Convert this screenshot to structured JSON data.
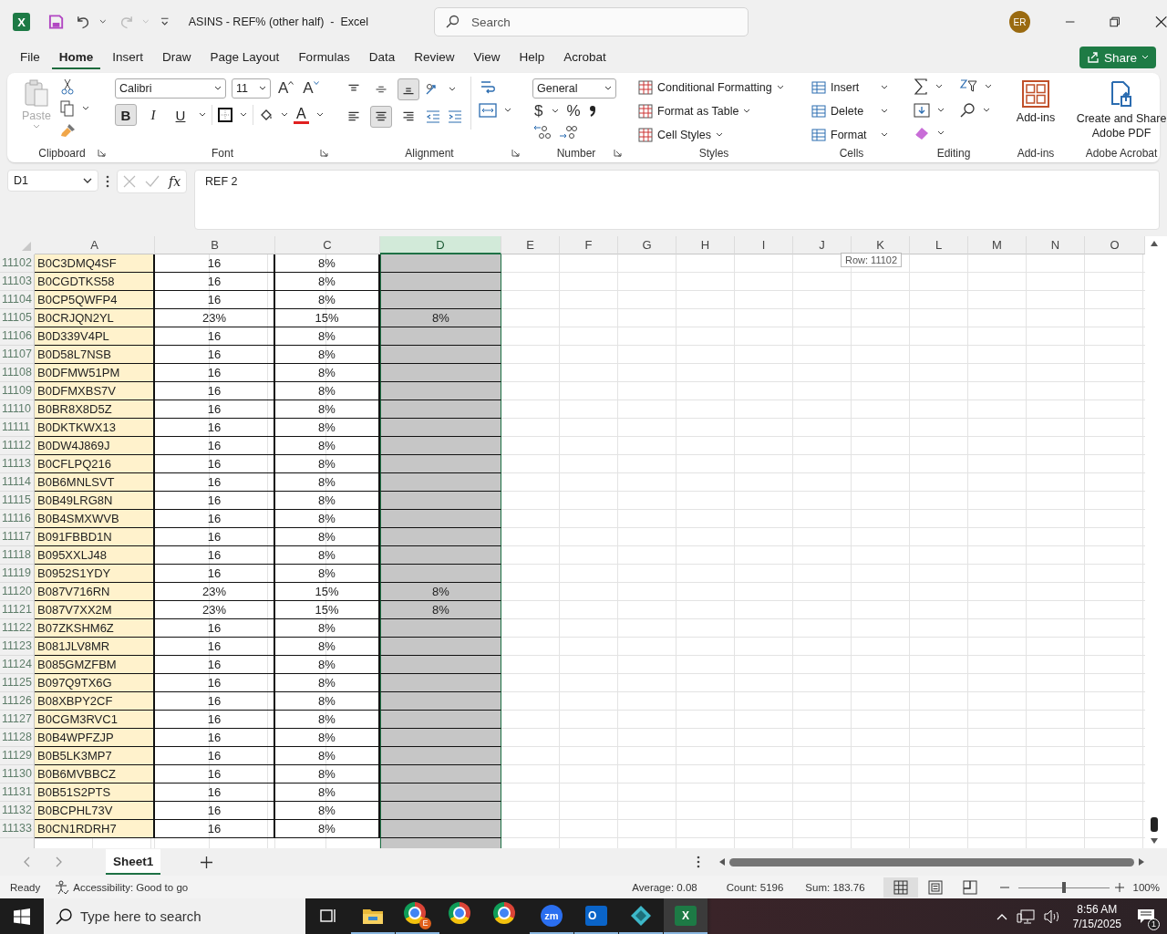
{
  "title_bar": {
    "app_letter": "X",
    "title": "ASINS - REF% (other half)  -  Excel",
    "search_placeholder": "Search",
    "avatar": "ER"
  },
  "menu_tabs": [
    {
      "label": "File",
      "selected": false
    },
    {
      "label": "Home",
      "selected": true
    },
    {
      "label": "Insert",
      "selected": false
    },
    {
      "label": "Draw",
      "selected": false
    },
    {
      "label": "Page Layout",
      "selected": false
    },
    {
      "label": "Formulas",
      "selected": false
    },
    {
      "label": "Data",
      "selected": false
    },
    {
      "label": "Review",
      "selected": false
    },
    {
      "label": "View",
      "selected": false
    },
    {
      "label": "Help",
      "selected": false
    },
    {
      "label": "Acrobat",
      "selected": false
    }
  ],
  "share_button": "Share",
  "ribbon": {
    "clipboard": {
      "paste": "Paste",
      "label": "Clipboard"
    },
    "font": {
      "family": "Calibri",
      "size": "11",
      "grow": "A",
      "shrink": "A",
      "font_color": "A",
      "label": "Font",
      "buttons": [
        {
          "kind": "bold",
          "glyph": "B",
          "selected": true
        },
        {
          "kind": "italic",
          "glyph": "I",
          "selected": false
        },
        {
          "kind": "underline",
          "glyph": "U",
          "selected": false
        }
      ]
    },
    "alignment": {
      "label": "Alignment",
      "vertical": [
        {
          "kind": "top",
          "selected": false
        },
        {
          "kind": "middle",
          "selected": false
        },
        {
          "kind": "bottom",
          "selected": true
        }
      ],
      "horizontal": [
        {
          "kind": "left",
          "selected": false
        },
        {
          "kind": "center",
          "selected": true
        },
        {
          "kind": "right",
          "selected": false
        }
      ]
    },
    "number": {
      "format": "General",
      "currency": "$",
      "percent": "%",
      "label": "Number"
    },
    "styles": {
      "items": [
        "Conditional Formatting",
        "Format as Table",
        "Cell Styles"
      ],
      "label": "Styles"
    },
    "cells": {
      "items": [
        "Insert",
        "Delete",
        "Format"
      ],
      "label": "Cells"
    },
    "editing": {
      "label": "Editing"
    },
    "addins": {
      "button": "Add-ins",
      "label": "Add-ins"
    },
    "acrobat": {
      "button": "Create and Share Adobe PDF",
      "label": "Adobe Acrobat"
    }
  },
  "formula_bar": {
    "name_box": "D1",
    "function_label": "fx",
    "formula": "REF 2"
  },
  "grid": {
    "columns": [
      {
        "label": "A",
        "selected": false
      },
      {
        "label": "B",
        "selected": false
      },
      {
        "label": "C",
        "selected": false
      },
      {
        "label": "D",
        "selected": true
      },
      {
        "label": "E",
        "selected": false
      },
      {
        "label": "F",
        "selected": false
      },
      {
        "label": "G",
        "selected": false
      },
      {
        "label": "H",
        "selected": false
      },
      {
        "label": "I",
        "selected": false
      },
      {
        "label": "J",
        "selected": false
      },
      {
        "label": "K",
        "selected": false
      },
      {
        "label": "L",
        "selected": false
      },
      {
        "label": "M",
        "selected": false
      },
      {
        "label": "N",
        "selected": false
      },
      {
        "label": "O",
        "selected": false
      }
    ],
    "rows": [
      {
        "row": "11102",
        "cells": [
          "B0C3DMQ4SF",
          "16",
          "8%"
        ]
      },
      {
        "row": "11103",
        "cells": [
          "B0CGDTKS58",
          "16",
          "8%"
        ]
      },
      {
        "row": "11104",
        "cells": [
          "B0CP5QWFP4",
          "16",
          "8%"
        ]
      },
      {
        "row": "11105",
        "cells": [
          "B0CRJQN2YL",
          "23%",
          "15%",
          "8%"
        ]
      },
      {
        "row": "11106",
        "cells": [
          "B0D339V4PL",
          "16",
          "8%"
        ]
      },
      {
        "row": "11107",
        "cells": [
          "B0D58L7NSB",
          "16",
          "8%"
        ]
      },
      {
        "row": "11108",
        "cells": [
          "B0DFMW51PM",
          "16",
          "8%"
        ]
      },
      {
        "row": "11109",
        "cells": [
          "B0DFMXBS7V",
          "16",
          "8%"
        ]
      },
      {
        "row": "11110",
        "cells": [
          "B0BR8X8D5Z",
          "16",
          "8%"
        ]
      },
      {
        "row": "11111",
        "cells": [
          "B0DKTKWX13",
          "16",
          "8%"
        ]
      },
      {
        "row": "11112",
        "cells": [
          "B0DW4J869J",
          "16",
          "8%"
        ]
      },
      {
        "row": "11113",
        "cells": [
          "B0CFLPQ216",
          "16",
          "8%"
        ]
      },
      {
        "row": "11114",
        "cells": [
          "B0B6MNLSVT",
          "16",
          "8%"
        ]
      },
      {
        "row": "11115",
        "cells": [
          "B0B49LRG8N",
          "16",
          "8%"
        ]
      },
      {
        "row": "11116",
        "cells": [
          "B0B4SMXWVB",
          "16",
          "8%"
        ]
      },
      {
        "row": "11117",
        "cells": [
          "B091FBBD1N",
          "16",
          "8%"
        ]
      },
      {
        "row": "11118",
        "cells": [
          "B095XXLJ48",
          "16",
          "8%"
        ]
      },
      {
        "row": "11119",
        "cells": [
          "B0952S1YDY",
          "16",
          "8%"
        ]
      },
      {
        "row": "11120",
        "cells": [
          "B087V716RN",
          "23%",
          "15%",
          "8%"
        ]
      },
      {
        "row": "11121",
        "cells": [
          "B087V7XX2M",
          "23%",
          "15%",
          "8%"
        ]
      },
      {
        "row": "11122",
        "cells": [
          "B07ZKSHM6Z",
          "16",
          "8%"
        ]
      },
      {
        "row": "11123",
        "cells": [
          "B081JLV8MR",
          "16",
          "8%"
        ]
      },
      {
        "row": "11124",
        "cells": [
          "B085GMZFBM",
          "16",
          "8%"
        ]
      },
      {
        "row": "11125",
        "cells": [
          "B097Q9TX6G",
          "16",
          "8%"
        ]
      },
      {
        "row": "11126",
        "cells": [
          "B08XBPY2CF",
          "16",
          "8%"
        ]
      },
      {
        "row": "11127",
        "cells": [
          "B0CGM3RVC1",
          "16",
          "8%"
        ]
      },
      {
        "row": "11128",
        "cells": [
          "B0B4WPFZJP",
          "16",
          "8%"
        ]
      },
      {
        "row": "11129",
        "cells": [
          "B0B5LK3MP7",
          "16",
          "8%"
        ]
      },
      {
        "row": "11130",
        "cells": [
          "B0B6MVBBCZ",
          "16",
          "8%"
        ]
      },
      {
        "row": "11131",
        "cells": [
          "B0B51S2PTS",
          "16",
          "8%"
        ]
      },
      {
        "row": "11132",
        "cells": [
          "B0BCPHL73V",
          "16",
          "8%"
        ]
      },
      {
        "row": "11133",
        "cells": [
          "B0CN1RDRH7",
          "16",
          "8%"
        ]
      }
    ],
    "tooltip": "Row: 11102"
  },
  "sheet_tabs": [
    {
      "label": "Sheet1",
      "selected": true
    }
  ],
  "status_bar": {
    "ready": "Ready",
    "accessibility": "Accessibility: Good to go",
    "average": "Average: 0.08",
    "count": "Count: 5196",
    "sum": "Sum: 183.76",
    "views": [
      {
        "kind": "normal",
        "selected": true
      },
      {
        "kind": "page_layout",
        "selected": false
      },
      {
        "kind": "page_break",
        "selected": false
      }
    ],
    "zoom_slider": {
      "level": 0.5
    },
    "zoom": "100%"
  },
  "taskbar": {
    "search_placeholder": "Type here to search",
    "apps": [
      {
        "kind": "task_view",
        "running": false,
        "active": false
      },
      {
        "kind": "folder",
        "running": true,
        "active": false
      },
      {
        "kind": "browser",
        "badge": "E",
        "running": true,
        "active": false
      },
      {
        "kind": "browser",
        "running": false,
        "active": false
      },
      {
        "kind": "browser",
        "running": false,
        "active": false
      },
      {
        "kind": "video",
        "glyph": "zm",
        "running": true,
        "active": false
      },
      {
        "kind": "mail",
        "glyph": "O",
        "running": true,
        "active": false
      },
      {
        "kind": "diamond",
        "running": true,
        "active": false
      },
      {
        "kind": "sheet",
        "glyph": "X",
        "running": true,
        "active": true
      }
    ],
    "time": "8:56 AM",
    "date": "7/15/2025",
    "notifications": "1"
  }
}
